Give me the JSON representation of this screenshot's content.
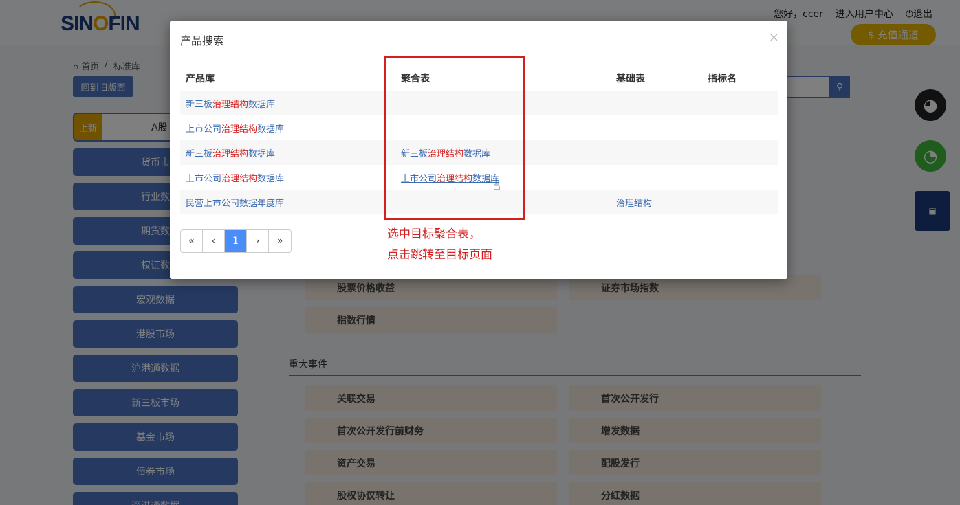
{
  "header": {
    "logo_text_a": "SIN",
    "logo_text_o": "O",
    "logo_text_b": "FIN",
    "greeting": "您好，ccer",
    "user_center": "进入用户中心",
    "logout": "退出",
    "recharge": "充值通道"
  },
  "breadcrumb": {
    "home": "首页",
    "sep": "/",
    "current": "标准库"
  },
  "old_version_button": "回到旧版面",
  "new_box": {
    "tag": "上新",
    "text": "A股"
  },
  "sidebar": {
    "items": [
      {
        "label": "货币市"
      },
      {
        "label": "行业数"
      },
      {
        "label": "期货数"
      },
      {
        "label": "权证数"
      },
      {
        "label": "宏观数据"
      },
      {
        "label": "港股市场"
      },
      {
        "label": "沪港通数据"
      },
      {
        "label": "新三板市场"
      },
      {
        "label": "基金市场"
      },
      {
        "label": "债券市场"
      },
      {
        "label": "深港通数据"
      }
    ]
  },
  "sections": {
    "market": {
      "cards": [
        "股票价格收益",
        "证券市场指数",
        "指数行情"
      ]
    },
    "events": {
      "title": "重大事件",
      "cards": [
        "关联交易",
        "首次公开发行",
        "首次公开发行前财务",
        "增发数据",
        "资产交易",
        "配股发行",
        "股权协议转让",
        "分红数据"
      ]
    }
  },
  "modal": {
    "title": "产品搜索",
    "close": "×",
    "columns": [
      "产品库",
      "聚合表",
      "基础表",
      "指标名"
    ],
    "rows": [
      {
        "lib_a": "新三板",
        "lib_hl": "治理结构",
        "lib_b": "数据库",
        "agg_a": "",
        "agg_hl": "",
        "agg_b": "",
        "base": "",
        "ind": ""
      },
      {
        "lib_a": "上市公司",
        "lib_hl": "治理结构",
        "lib_b": "数据库",
        "agg_a": "",
        "agg_hl": "",
        "agg_b": "",
        "base": "",
        "ind": ""
      },
      {
        "lib_a": "新三板",
        "lib_hl": "治理结构",
        "lib_b": "数据库",
        "agg_a": "新三板",
        "agg_hl": "治理结构",
        "agg_b": "数据库",
        "base": "",
        "ind": ""
      },
      {
        "lib_a": "上市公司",
        "lib_hl": "治理结构",
        "lib_b": "数据库",
        "agg_a": "上市公司",
        "agg_hl": "治理结构",
        "agg_b": "数据库",
        "base": "",
        "ind": ""
      },
      {
        "lib_a": "民营上市公司数据年度库",
        "lib_hl": "",
        "lib_b": "",
        "agg_a": "",
        "agg_hl": "",
        "agg_b": "",
        "base": "治理结构",
        "ind": ""
      }
    ],
    "pager": [
      "«",
      "‹",
      "1",
      "›",
      "»"
    ],
    "annotation_line1": "选中目标聚合表，",
    "annotation_line2": "点击跳转至目标页面"
  }
}
